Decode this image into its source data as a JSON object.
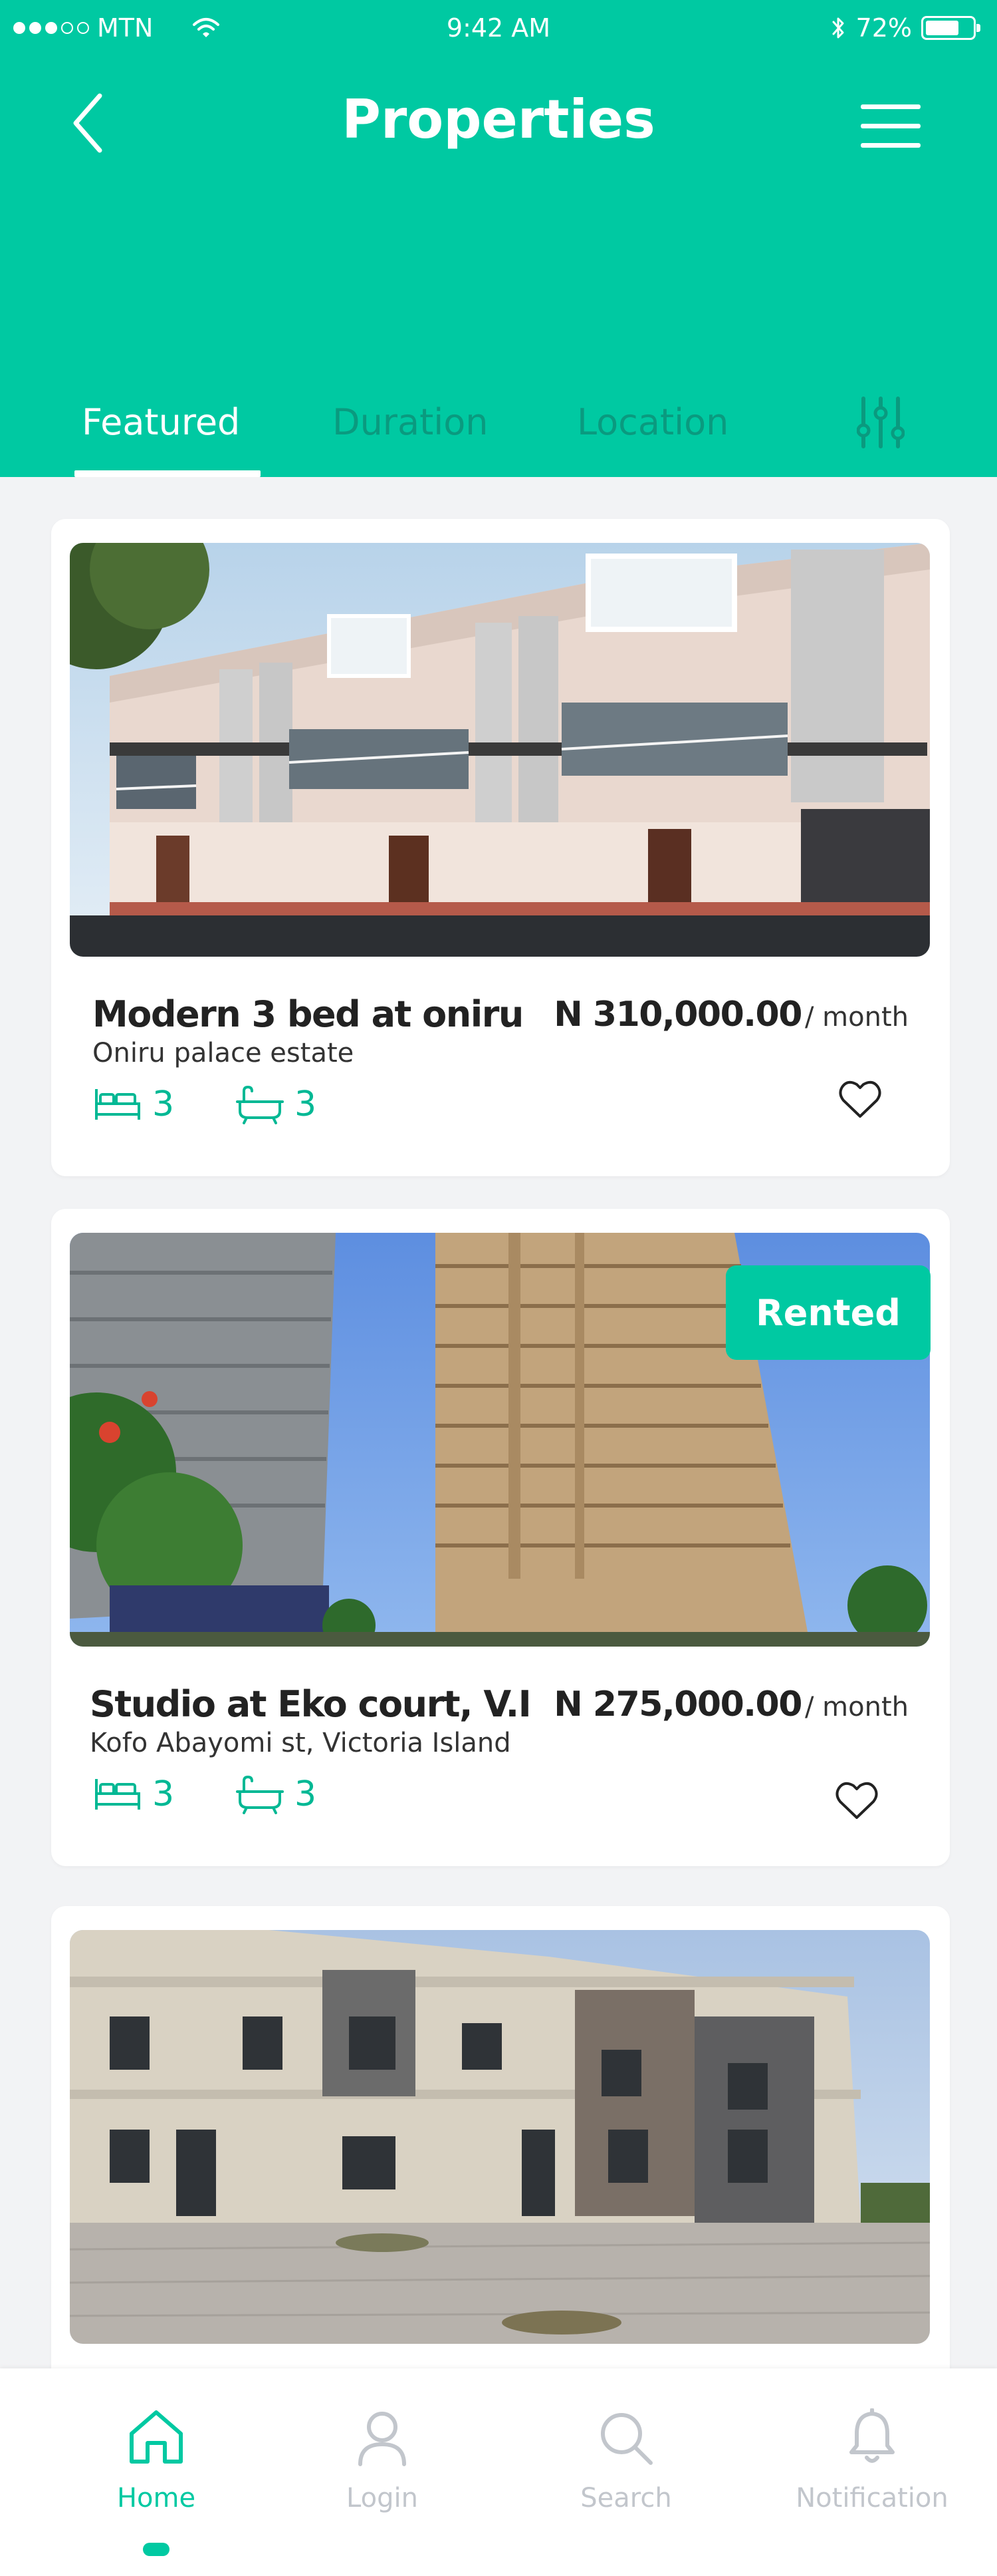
{
  "status_bar": {
    "carrier": "MTN",
    "time": "9:42 AM",
    "battery": "72%",
    "battery_level": 0.72,
    "signal_bars": 3,
    "signal_total": 5
  },
  "header": {
    "title": "Properties"
  },
  "tabs": [
    {
      "label": "Featured",
      "active": true
    },
    {
      "label": "Duration",
      "active": false
    },
    {
      "label": "Location",
      "active": false
    }
  ],
  "listings": [
    {
      "title": "Modern 3 bed at oniru",
      "location": "Oniru palace estate",
      "price": "N 310,000.00",
      "period": "/ month",
      "beds": "3",
      "baths": "3",
      "badge": ""
    },
    {
      "title": "Studio at Eko court, V.I",
      "location": "Kofo Abayomi st, Victoria  Island",
      "price": "N 275,000.00",
      "period": "/ month",
      "beds": "3",
      "baths": "3",
      "badge": "Rented"
    },
    {
      "title": "",
      "location": "",
      "price": "",
      "period": "",
      "beds": "",
      "baths": "",
      "badge": ""
    }
  ],
  "bottom_nav": [
    {
      "label": "Home",
      "icon": "home-icon",
      "active": true
    },
    {
      "label": "Login",
      "icon": "user-icon",
      "active": false
    },
    {
      "label": "Search",
      "icon": "search-icon",
      "active": false
    },
    {
      "label": "Notification",
      "icon": "bell-icon",
      "active": false
    }
  ],
  "colors": {
    "brand": "#00c9a2",
    "tab_inactive": "#0a9a7f",
    "amenity": "#00b894",
    "inactive_nav": "#c2c6cc"
  }
}
